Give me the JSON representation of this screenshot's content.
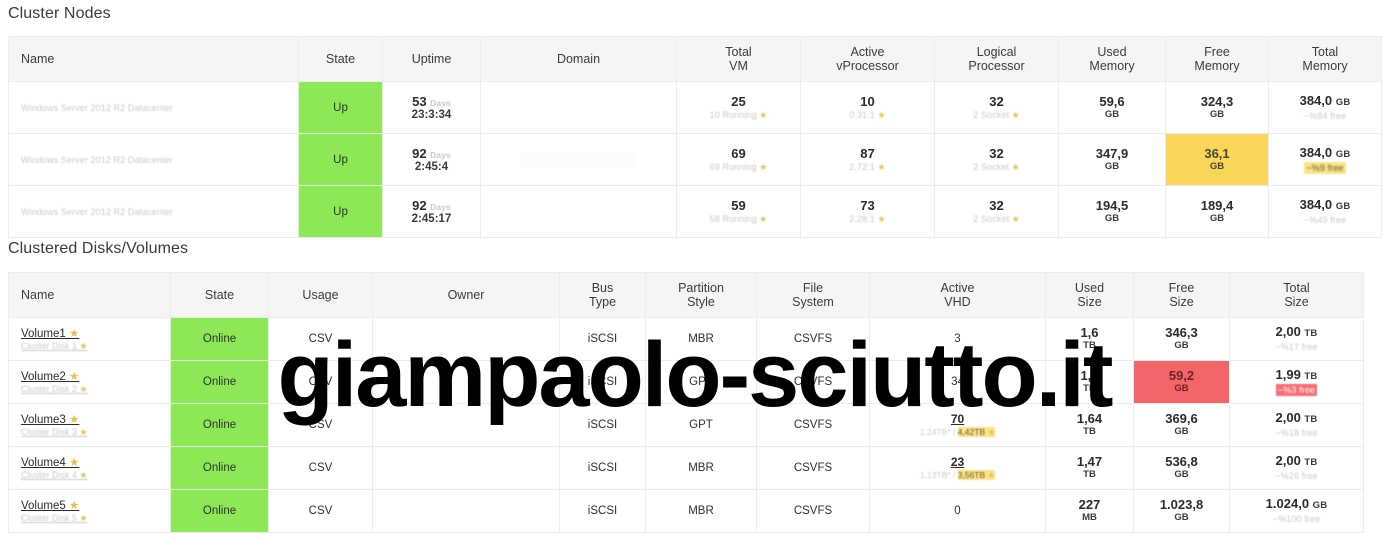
{
  "sections": {
    "nodes_title": "Cluster Nodes",
    "volumes_title": "Clustered Disks/Volumes"
  },
  "watermark": "giampaolo-sciutto.it",
  "colors": {
    "ok_green": "#8CE854",
    "warn_yellow": "#F7D65A",
    "danger_red": "#F4656A",
    "badge_warn": "#FBE38B",
    "badge_danger": "#FA6C72",
    "header_bg": "#F5F5F5",
    "border": "#ECECEC"
  },
  "nodes_table": {
    "headers": [
      "Name",
      "State",
      "Uptime",
      "Domain",
      "Total\nVM",
      "Active\nvProcessor",
      "Logical\nProcessor",
      "Used\nMemory",
      "Free\nMemory",
      "Total\nMemory"
    ],
    "headers_split": [
      {
        "l1": "Name",
        "l2": ""
      },
      {
        "l1": "State",
        "l2": ""
      },
      {
        "l1": "Uptime",
        "l2": ""
      },
      {
        "l1": "Domain",
        "l2": ""
      },
      {
        "l1": "Total",
        "l2": "VM"
      },
      {
        "l1": "Active",
        "l2": "vProcessor"
      },
      {
        "l1": "Logical",
        "l2": "Processor"
      },
      {
        "l1": "Used",
        "l2": "Memory"
      },
      {
        "l1": "Free",
        "l2": "Memory"
      },
      {
        "l1": "Total",
        "l2": "Memory"
      }
    ],
    "rows": [
      {
        "name_sub": "Windows Server 2012 R2 Datacenter",
        "state": "Up",
        "uptime_days": "53",
        "uptime_days_label": "Days",
        "uptime_clock": "23:3:34",
        "domain": "",
        "total_vm": "25",
        "total_vm_sub": "10 Running",
        "active_vproc": "10",
        "active_vproc_sub": "0,31:1",
        "logical_proc": "32",
        "logical_proc_sub": "2 Socket",
        "used_memory": "59,6",
        "used_memory_unit": "GB",
        "free_memory": "324,3",
        "free_memory_unit": "GB",
        "free_memory_state": "normal",
        "total_memory": "384,0",
        "total_memory_unit": "GB",
        "total_memory_sub": "~%84 free",
        "total_memory_state": "normal"
      },
      {
        "name_sub": "Windows Server 2012 R2 Datacenter",
        "state": "Up",
        "uptime_days": "92",
        "uptime_days_label": "Days",
        "uptime_clock": "2:45:4",
        "domain": "",
        "total_vm": "69",
        "total_vm_sub": "69 Running",
        "active_vproc": "87",
        "active_vproc_sub": "2,72:1",
        "logical_proc": "32",
        "logical_proc_sub": "2 Socket",
        "used_memory": "347,9",
        "used_memory_unit": "GB",
        "free_memory": "36,1",
        "free_memory_unit": "GB",
        "free_memory_state": "warn",
        "total_memory": "384,0",
        "total_memory_unit": "GB",
        "total_memory_sub": "~%9 free",
        "total_memory_state": "warn"
      },
      {
        "name_sub": "Windows Server 2012 R2 Datacenter",
        "state": "Up",
        "uptime_days": "92",
        "uptime_days_label": "Days",
        "uptime_clock": "2:45:17",
        "domain": "",
        "total_vm": "59",
        "total_vm_sub": "58 Running",
        "active_vproc": "73",
        "active_vproc_sub": "2,28:1",
        "logical_proc": "32",
        "logical_proc_sub": "2 Socket",
        "used_memory": "194,5",
        "used_memory_unit": "GB",
        "free_memory": "189,4",
        "free_memory_unit": "GB",
        "free_memory_state": "normal",
        "total_memory": "384,0",
        "total_memory_unit": "GB",
        "total_memory_sub": "~%49 free",
        "total_memory_state": "normal"
      }
    ]
  },
  "volumes_table": {
    "headers_split": [
      {
        "l1": "Name",
        "l2": ""
      },
      {
        "l1": "State",
        "l2": ""
      },
      {
        "l1": "Usage",
        "l2": ""
      },
      {
        "l1": "Owner",
        "l2": ""
      },
      {
        "l1": "Bus",
        "l2": "Type"
      },
      {
        "l1": "Partition",
        "l2": "Style"
      },
      {
        "l1": "File",
        "l2": "System"
      },
      {
        "l1": "Active",
        "l2": "VHD"
      },
      {
        "l1": "Used",
        "l2": "Size"
      },
      {
        "l1": "Free",
        "l2": "Size"
      },
      {
        "l1": "Total",
        "l2": "Size"
      }
    ],
    "rows": [
      {
        "name": "Volume1",
        "name_sub": "Cluster Disk 1",
        "state": "Online",
        "usage": "CSV",
        "owner": "",
        "bus_type": "iSCSI",
        "partition_style": "MBR",
        "file_system": "CSVFS",
        "active_vhd": "3",
        "active_vhd_sub_left": "",
        "active_vhd_sub_right": "",
        "used_size": "1,6",
        "used_size_unit": "TB",
        "free_size": "346,3",
        "free_size_unit": "GB",
        "free_size_state": "normal",
        "total_size": "2,00",
        "total_size_unit": "TB",
        "total_size_sub": "~%17 free",
        "total_size_state": "normal"
      },
      {
        "name": "Volume2",
        "name_sub": "Cluster Disk 2",
        "state": "Online",
        "usage": "CSV",
        "owner": "",
        "bus_type": "iSCSI",
        "partition_style": "GPT",
        "file_system": "CSVFS",
        "active_vhd": "34",
        "active_vhd_sub_left": "",
        "active_vhd_sub_right": "",
        "used_size": "1,9",
        "used_size_unit": "TB",
        "free_size": "59,2",
        "free_size_unit": "GB",
        "free_size_state": "danger",
        "total_size": "1,99",
        "total_size_unit": "TB",
        "total_size_sub": "~%3 free",
        "total_size_state": "danger"
      },
      {
        "name": "Volume3",
        "name_sub": "Cluster Disk 3",
        "state": "Online",
        "usage": "CSV",
        "owner": "",
        "bus_type": "iSCSI",
        "partition_style": "GPT",
        "file_system": "CSVFS",
        "active_vhd": "70",
        "active_vhd_sub_left": "1,24TB*",
        "active_vhd_sub_right": "4,42TB",
        "used_size": "1,64",
        "used_size_unit": "TB",
        "free_size": "369,6",
        "free_size_unit": "GB",
        "free_size_state": "normal",
        "total_size": "2,00",
        "total_size_unit": "TB",
        "total_size_sub": "~%18 free",
        "total_size_state": "normal"
      },
      {
        "name": "Volume4",
        "name_sub": "Cluster Disk 4",
        "state": "Online",
        "usage": "CSV",
        "owner": "",
        "bus_type": "iSCSI",
        "partition_style": "MBR",
        "file_system": "CSVFS",
        "active_vhd": "23",
        "active_vhd_sub_left": "1,13TB*",
        "active_vhd_sub_right": "3,56TB",
        "used_size": "1,47",
        "used_size_unit": "TB",
        "free_size": "536,8",
        "free_size_unit": "GB",
        "free_size_state": "normal",
        "total_size": "2,00",
        "total_size_unit": "TB",
        "total_size_sub": "~%26 free",
        "total_size_state": "normal"
      },
      {
        "name": "Volume5",
        "name_sub": "Cluster Disk 5",
        "state": "Online",
        "usage": "CSV",
        "owner": "",
        "bus_type": "iSCSI",
        "partition_style": "MBR",
        "file_system": "CSVFS",
        "active_vhd": "0",
        "active_vhd_sub_left": "",
        "active_vhd_sub_right": "",
        "used_size": "227",
        "used_size_unit": "MB",
        "free_size": "1.023,8",
        "free_size_unit": "GB",
        "free_size_state": "normal",
        "total_size": "1.024,0",
        "total_size_unit": "GB",
        "total_size_sub": "~%100 free",
        "total_size_state": "normal"
      }
    ]
  }
}
